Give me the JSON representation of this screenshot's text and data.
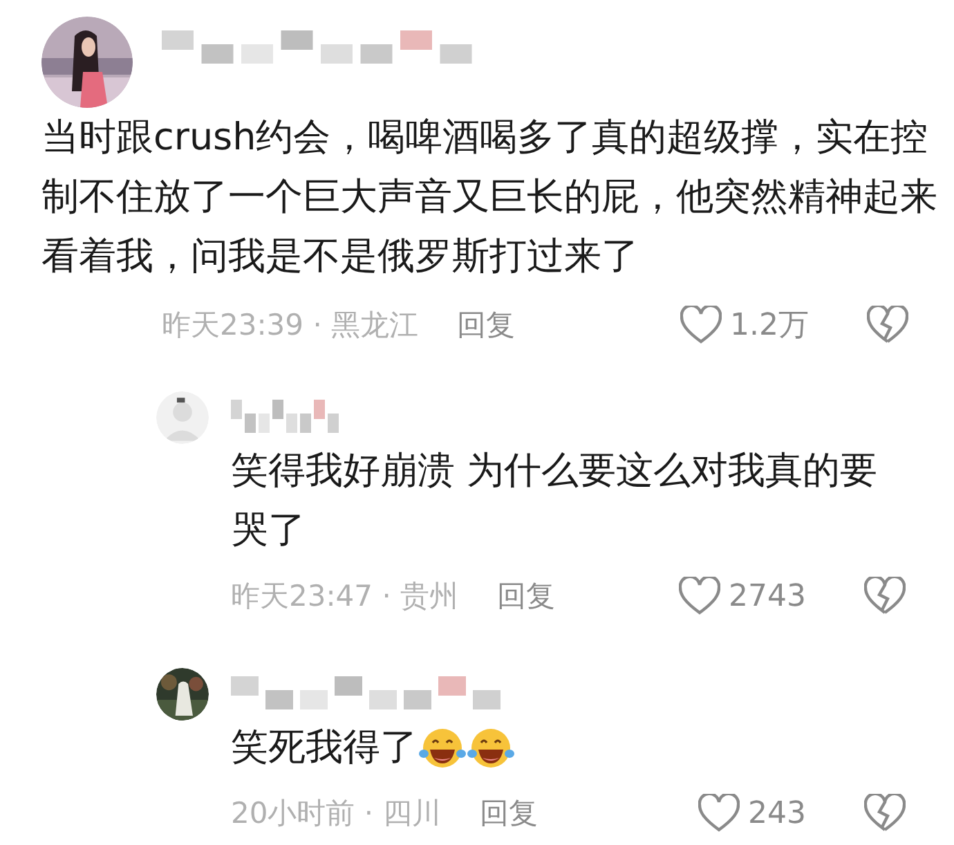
{
  "comment": {
    "text": "当时跟crush约会，喝啤酒喝多了真的超级撑，实在控制不住放了一个巨大声音又巨长的屁，他突然精神起来看着我，问我是不是俄罗斯打过来了",
    "time": "昨天23:39",
    "separator": "·",
    "location": "黑龙江",
    "reply_label": "回复",
    "likes": "1.2万",
    "replies": [
      {
        "text": "笑得我好崩溃 为什么要这么对我真的要哭了",
        "time": "昨天23:47",
        "separator": "·",
        "location": "贵州",
        "reply_label": "回复",
        "likes": "2743"
      },
      {
        "text": "笑死我得了",
        "emojis": [
          {
            "kind": "laugh-cry"
          },
          {
            "kind": "laugh-cry"
          }
        ],
        "time": "20小时前",
        "separator": "·",
        "location": "四川",
        "reply_label": "回复",
        "likes": "243"
      }
    ]
  }
}
